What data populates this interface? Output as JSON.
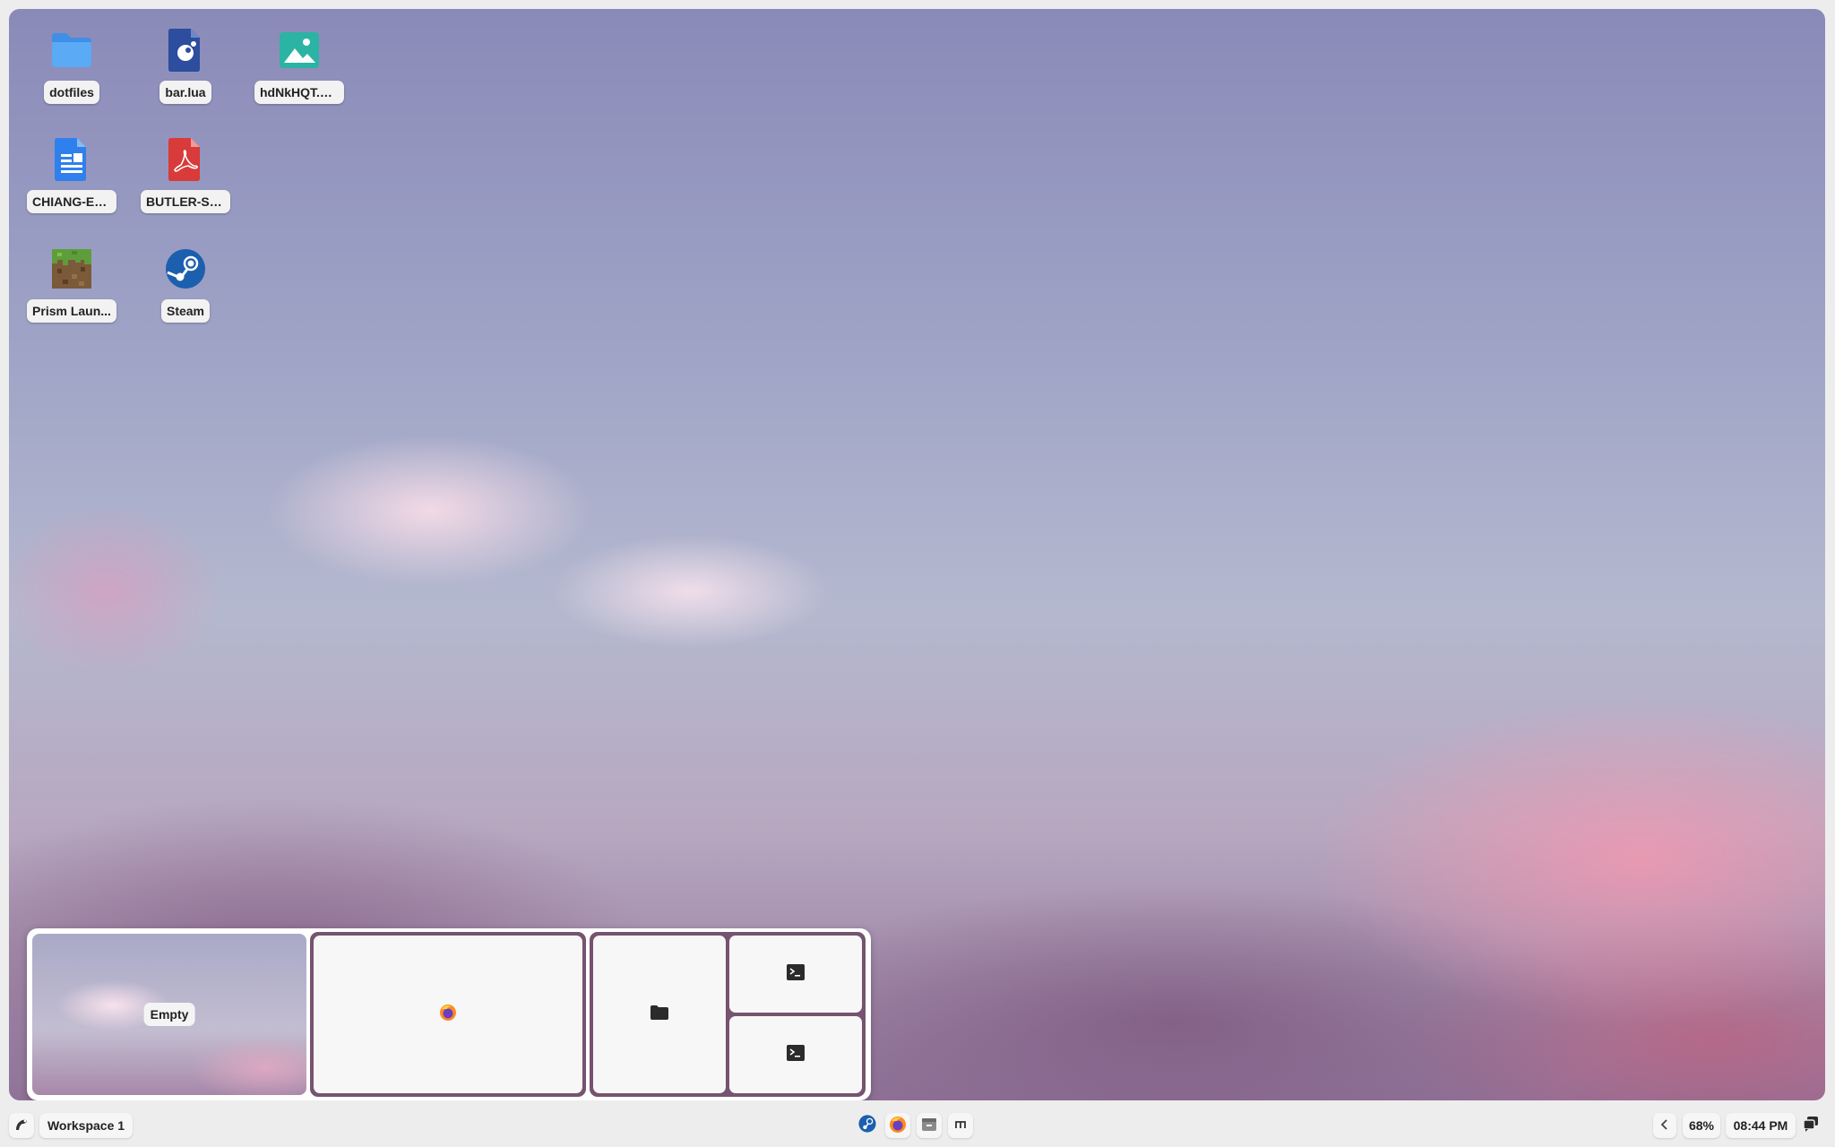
{
  "desktop": {
    "icons": [
      {
        "label": "dotfiles",
        "icon": "folder-icon"
      },
      {
        "label": "bar.lua",
        "icon": "lua-file-icon"
      },
      {
        "label": "hdNkHQT.png",
        "icon": "image-file-icon"
      },
      {
        "label": "CHIANG-Ex...",
        "icon": "document-icon"
      },
      {
        "label": "BUTLER-Sp...",
        "icon": "pdf-icon"
      },
      {
        "label": "Prism Laun...",
        "icon": "prism-launcher-icon"
      },
      {
        "label": "Steam",
        "icon": "steam-icon"
      }
    ]
  },
  "overview": {
    "workspaces": [
      {
        "label": "Empty"
      },
      {
        "windows": [
          "firefox-icon"
        ]
      },
      {
        "windows": [
          "folder-icon",
          "terminal-icon",
          "terminal-icon"
        ]
      }
    ]
  },
  "taskbar": {
    "workspace_label": "Workspace 1",
    "apps": [
      "steam-icon",
      "firefox-icon",
      "files-icon",
      "music-icon"
    ],
    "battery": "68%",
    "clock": "08:44 PM"
  },
  "colors": {
    "folder_blue": "#4a9cf0",
    "lua_blue": "#2d4d9e",
    "image_teal": "#2bb3a3",
    "doc_blue": "#2f80ed",
    "pdf_red": "#d93a3a",
    "steam_blue": "#1b5fae",
    "active_workspace_frame": "#76536f"
  }
}
